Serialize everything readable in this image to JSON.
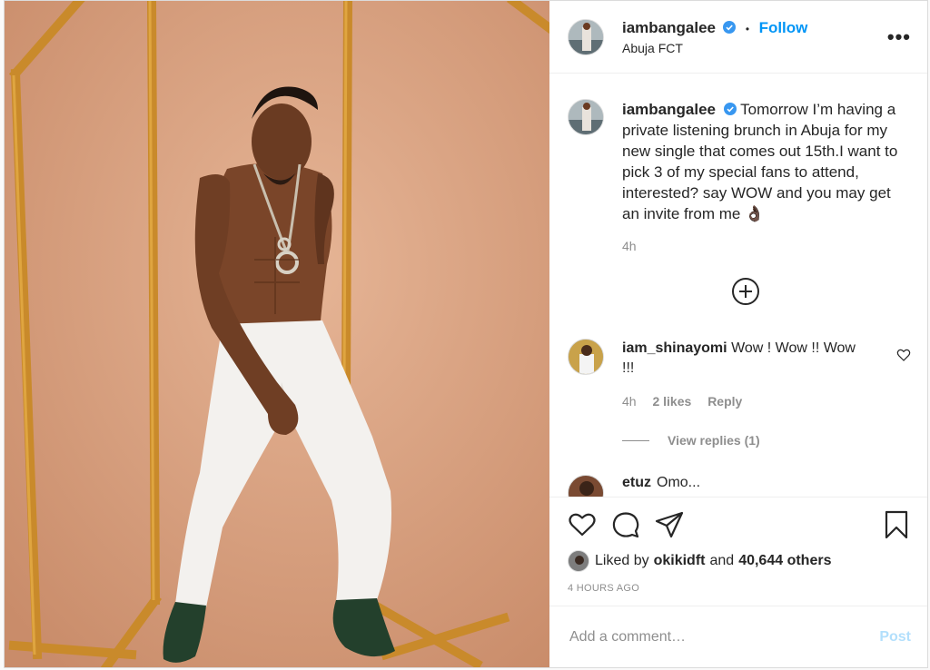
{
  "colors": {
    "accent": "#0095f6",
    "muted": "#8e8e8e",
    "backdrop": "#d9a07f",
    "frame": "#c98a2b"
  },
  "header": {
    "username": "iambangalee",
    "dot": "•",
    "follow_label": "Follow",
    "location": "Abuja FCT",
    "more_label": "•••"
  },
  "caption": {
    "username": "iambangalee",
    "text": "Tomorrow I’m having a private listening brunch in Abuja for my new single that comes out 15th.I want to pick 3 of my special fans to attend, interested? say WOW and you may get an invite from me 👌🏿",
    "time": "4h"
  },
  "comments": [
    {
      "username": "iam_shinayomi",
      "text": "Wow ! Wow !! Wow !!!",
      "time": "4h",
      "likes": "2 likes",
      "reply_label": "Reply",
      "view_replies": "View replies (1)"
    },
    {
      "username": "etuz",
      "text": "Omo..."
    }
  ],
  "likes": {
    "prefix": "Liked by",
    "user": "okikidft",
    "and": "and",
    "others": "40,644 others"
  },
  "posted": "4 HOURS AGO",
  "add_comment": {
    "placeholder": "Add a comment…",
    "post_label": "Post"
  },
  "icons": {
    "like": "heart-icon",
    "comment": "comment-bubble-icon",
    "share": "paper-plane-icon",
    "save": "bookmark-icon",
    "load_more": "plus-circle-icon",
    "verified": "verified-badge-icon"
  }
}
